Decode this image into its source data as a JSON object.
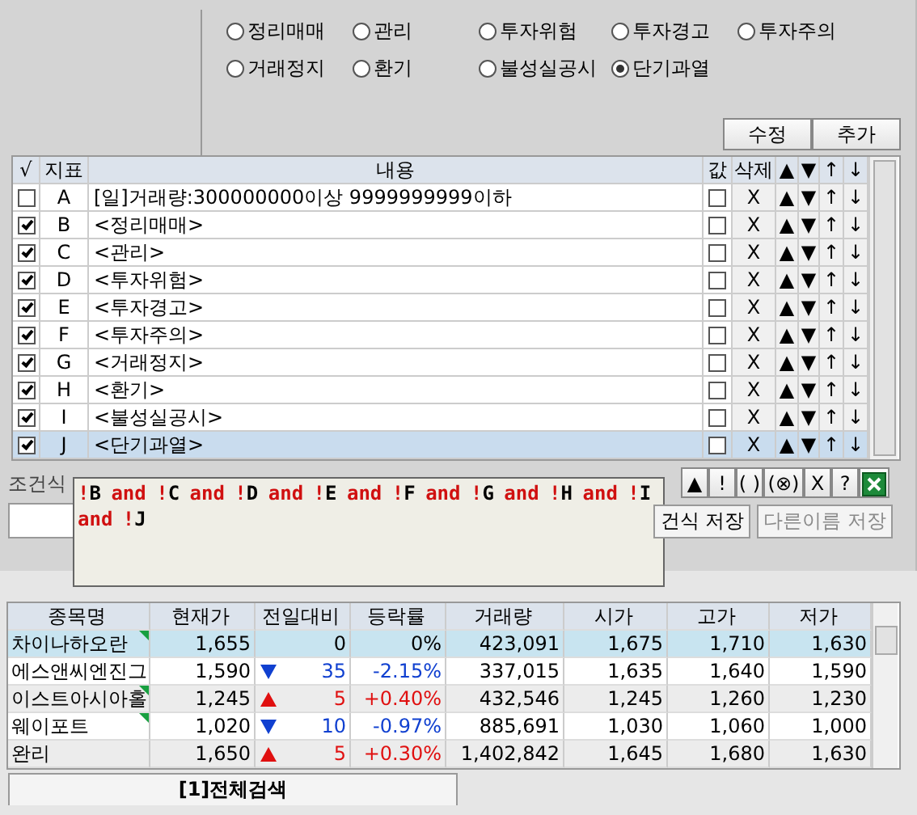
{
  "filters": [
    {
      "label": "정리매매",
      "selected": false
    },
    {
      "label": "관리",
      "selected": false
    },
    {
      "label": "투자위험",
      "selected": false
    },
    {
      "label": "투자경고",
      "selected": false
    },
    {
      "label": "투자주의",
      "selected": false
    },
    {
      "label": "거래정지",
      "selected": false
    },
    {
      "label": "환기",
      "selected": false
    },
    {
      "label": "불성실공시",
      "selected": false
    },
    {
      "label": "단기과열",
      "selected": true
    }
  ],
  "top_buttons": [
    "수정",
    "추가"
  ],
  "conditions": {
    "columns": [
      "√",
      "지표",
      "내용",
      "값",
      "삭제",
      "▲",
      "▼",
      "↑",
      "↓"
    ],
    "rows": [
      {
        "checked": false,
        "id": "A",
        "content": "[일]거래량:300000000이상 9999999999이하",
        "value_checked": false,
        "delete": "X",
        "selected": false
      },
      {
        "checked": true,
        "id": "B",
        "content": "<정리매매>",
        "value_checked": false,
        "delete": "X",
        "selected": false
      },
      {
        "checked": true,
        "id": "C",
        "content": "<관리>",
        "value_checked": false,
        "delete": "X",
        "selected": false
      },
      {
        "checked": true,
        "id": "D",
        "content": "<투자위험>",
        "value_checked": false,
        "delete": "X",
        "selected": false
      },
      {
        "checked": true,
        "id": "E",
        "content": "<투자경고>",
        "value_checked": false,
        "delete": "X",
        "selected": false
      },
      {
        "checked": true,
        "id": "F",
        "content": "<투자주의>",
        "value_checked": false,
        "delete": "X",
        "selected": false
      },
      {
        "checked": true,
        "id": "G",
        "content": "<거래정지>",
        "value_checked": false,
        "delete": "X",
        "selected": false
      },
      {
        "checked": true,
        "id": "H",
        "content": "<환기>",
        "value_checked": false,
        "delete": "X",
        "selected": false
      },
      {
        "checked": true,
        "id": "I",
        "content": "<불성실공시>",
        "value_checked": false,
        "delete": "X",
        "selected": false
      },
      {
        "checked": true,
        "id": "J",
        "content": "<단기과열>",
        "value_checked": false,
        "delete": "X",
        "selected": true
      }
    ],
    "row_buttons": [
      "▲",
      "▼",
      "↑",
      "↓"
    ]
  },
  "expression": {
    "label": "조건식",
    "tooltip_tokens": [
      {
        "kind": "op",
        "text": "!"
      },
      {
        "kind": "id",
        "text": "B"
      },
      {
        "kind": "op",
        "text": " and !"
      },
      {
        "kind": "id",
        "text": "C"
      },
      {
        "kind": "op",
        "text": " and !"
      },
      {
        "kind": "id",
        "text": "D"
      },
      {
        "kind": "op",
        "text": " and !"
      },
      {
        "kind": "id",
        "text": "E"
      },
      {
        "kind": "op",
        "text": " and !"
      },
      {
        "kind": "id",
        "text": "F"
      },
      {
        "kind": "op",
        "text": " and !"
      },
      {
        "kind": "id",
        "text": "G"
      },
      {
        "kind": "op",
        "text": " and !"
      },
      {
        "kind": "id",
        "text": "H"
      },
      {
        "kind": "op",
        "text": " and !"
      },
      {
        "kind": "id",
        "text": "I"
      },
      {
        "kind": "op",
        "text": " and !"
      },
      {
        "kind": "id",
        "text": "J"
      }
    ],
    "tool_buttons": [
      "▲",
      "!",
      "( )",
      "(⊗)",
      "X",
      "?"
    ],
    "save_button": "건식 저장",
    "save_as_button": {
      "label": "다른이름 저장",
      "disabled": true
    }
  },
  "results": {
    "columns": [
      "종목명",
      "현재가",
      "전일대비",
      "등락률",
      "거래량",
      "시가",
      "고가",
      "저가"
    ],
    "rows": [
      {
        "name": "차이나하오란",
        "flag": true,
        "selected": true,
        "price": "1,655",
        "kind": "flat",
        "change": "0",
        "rate": "0%",
        "volume": "423,091",
        "open": "1,675",
        "high": "1,710",
        "low": "1,630"
      },
      {
        "name": "에스앤씨엔진그",
        "flag": false,
        "selected": false,
        "price": "1,590",
        "kind": "down",
        "change": "35",
        "rate": "-2.15%",
        "volume": "337,015",
        "open": "1,635",
        "high": "1,640",
        "low": "1,590"
      },
      {
        "name": "이스트아시아홀",
        "flag": true,
        "selected": false,
        "price": "1,245",
        "kind": "up",
        "change": "5",
        "rate": "+0.40%",
        "volume": "432,546",
        "open": "1,245",
        "high": "1,260",
        "low": "1,230"
      },
      {
        "name": "웨이포트",
        "flag": true,
        "selected": false,
        "price": "1,020",
        "kind": "down",
        "change": "10",
        "rate": "-0.97%",
        "volume": "885,691",
        "open": "1,030",
        "high": "1,060",
        "low": "1,000"
      },
      {
        "name": "완리",
        "flag": false,
        "selected": false,
        "price": "1,650",
        "kind": "up",
        "change": "5",
        "rate": "+0.30%",
        "volume": "1,402,842",
        "open": "1,645",
        "high": "1,680",
        "low": "1,630"
      }
    ]
  },
  "tabs": [
    {
      "label": "[1]전체검색",
      "selected": true
    }
  ]
}
